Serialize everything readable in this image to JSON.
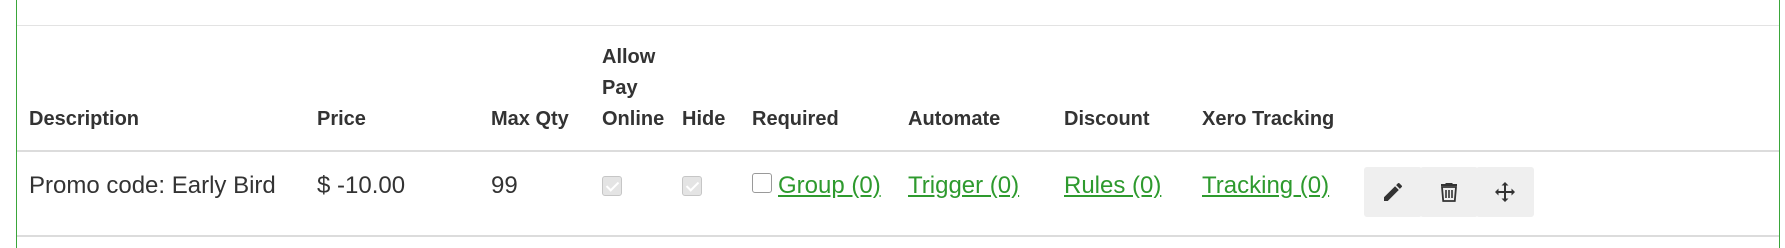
{
  "table": {
    "headers": {
      "description": "Description",
      "price": "Price",
      "max_qty": "Max Qty",
      "allow_pay_online": [
        "Allow",
        "Pay",
        "Online"
      ],
      "hide": "Hide",
      "required": "Required",
      "automate": "Automate",
      "discount": "Discount",
      "xero_tracking": "Xero Tracking"
    },
    "rows": [
      {
        "description": "Promo code: Early Bird",
        "price": "$ -10.00",
        "max_qty": "99",
        "allow_pay_online": true,
        "hide": true,
        "required": false,
        "group_link": "Group (0)",
        "trigger_link": "Trigger (0)",
        "rules_link": "Rules (0)",
        "tracking_link": "Tracking (0)"
      }
    ]
  },
  "row_actions": [
    "pencil-icon",
    "trash-icon",
    "move-arrows-icon"
  ],
  "colors": {
    "link": "#2e9a2e",
    "border_accent": "#3aa63a",
    "button_bg": "#efefef"
  }
}
